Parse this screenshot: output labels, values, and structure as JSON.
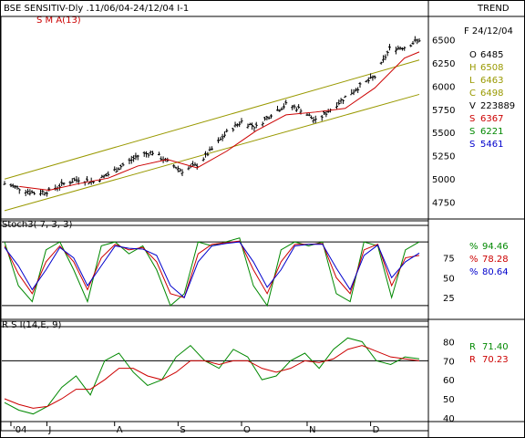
{
  "header": {
    "title": "BSE SENSITIV-Dly .11/06/04-24/12/04  I-1",
    "mode": "TREND"
  },
  "indicators": {
    "sma_label": "S M A(13)",
    "stoch_label": "Stoch3( 7, 3, 3)",
    "rsi_label": "R S I(14,E, 9)"
  },
  "info": {
    "date": "F 24/12/04",
    "rows": [
      {
        "key": "O",
        "value": "6485",
        "color": "#000000"
      },
      {
        "key": "H",
        "value": "6508",
        "color": "#999900"
      },
      {
        "key": "L",
        "value": "6463",
        "color": "#999900"
      },
      {
        "key": "C",
        "value": "6498",
        "color": "#999900"
      },
      {
        "key": "V",
        "value": "223889",
        "color": "#000000"
      },
      {
        "key": "S",
        "value": "6367",
        "color": "#cc0000"
      },
      {
        "key": "S",
        "value": "6221",
        "color": "#008800"
      },
      {
        "key": "S",
        "value": "5461",
        "color": "#0000cc"
      }
    ],
    "stoch_rows": [
      {
        "key": "%",
        "value": "94.46",
        "color": "#008800"
      },
      {
        "key": "%",
        "value": "78.28",
        "color": "#cc0000"
      },
      {
        "key": "%",
        "value": "80.64",
        "color": "#0000cc"
      }
    ],
    "rsi_rows": [
      {
        "key": "R",
        "value": "71.40",
        "color": "#008800"
      },
      {
        "key": "R",
        "value": "70.23",
        "color": "#cc0000"
      }
    ]
  },
  "chart_data": [
    {
      "type": "ohlc",
      "title": "BSE SENSITIV-Dly .11/06/04-24/12/04  I-1",
      "x_range": [
        "2004-06-11",
        "2004-12-24"
      ],
      "ylim": [
        4600,
        6650
      ],
      "yticks": [
        4750,
        5000,
        5250,
        5500,
        5750,
        6000,
        6250,
        6500
      ],
      "x_tick_labels": [
        "'04",
        "J",
        "A",
        "S",
        "O",
        "N",
        "D"
      ],
      "close_path": [
        {
          "x": "2004-06-11",
          "close": 4950
        },
        {
          "x": "2004-06-18",
          "close": 4900
        },
        {
          "x": "2004-06-25",
          "close": 4850
        },
        {
          "x": "2004-07-02",
          "close": 4870
        },
        {
          "x": "2004-07-09",
          "close": 4950
        },
        {
          "x": "2004-07-16",
          "close": 5000
        },
        {
          "x": "2004-07-23",
          "close": 4970
        },
        {
          "x": "2004-07-30",
          "close": 5050
        },
        {
          "x": "2004-08-06",
          "close": 5150
        },
        {
          "x": "2004-08-13",
          "close": 5250
        },
        {
          "x": "2004-08-20",
          "close": 5290
        },
        {
          "x": "2004-08-27",
          "close": 5180
        },
        {
          "x": "2004-09-03",
          "close": 5090
        },
        {
          "x": "2004-09-10",
          "close": 5150
        },
        {
          "x": "2004-09-17",
          "close": 5320
        },
        {
          "x": "2004-09-24",
          "close": 5500
        },
        {
          "x": "2004-10-01",
          "close": 5620
        },
        {
          "x": "2004-10-08",
          "close": 5560
        },
        {
          "x": "2004-10-15",
          "close": 5700
        },
        {
          "x": "2004-10-22",
          "close": 5800
        },
        {
          "x": "2004-10-29",
          "close": 5750
        },
        {
          "x": "2004-11-05",
          "close": 5620
        },
        {
          "x": "2004-11-12",
          "close": 5750
        },
        {
          "x": "2004-11-19",
          "close": 5880
        },
        {
          "x": "2004-11-26",
          "close": 6000
        },
        {
          "x": "2004-12-03",
          "close": 6100
        },
        {
          "x": "2004-12-10",
          "close": 6400
        },
        {
          "x": "2004-12-17",
          "close": 6420
        },
        {
          "x": "2004-12-24",
          "close": 6498
        }
      ],
      "sma": {
        "name": "S M A(13)",
        "color": "#cc0000",
        "points": [
          {
            "x": "2004-06-18",
            "value": 4920
          },
          {
            "x": "2004-07-02",
            "value": 4880
          },
          {
            "x": "2004-07-16",
            "value": 4950
          },
          {
            "x": "2004-07-30",
            "value": 5010
          },
          {
            "x": "2004-08-13",
            "value": 5140
          },
          {
            "x": "2004-08-27",
            "value": 5210
          },
          {
            "x": "2004-09-10",
            "value": 5120
          },
          {
            "x": "2004-09-24",
            "value": 5300
          },
          {
            "x": "2004-10-08",
            "value": 5520
          },
          {
            "x": "2004-10-22",
            "value": 5690
          },
          {
            "x": "2004-11-05",
            "value": 5720
          },
          {
            "x": "2004-11-19",
            "value": 5760
          },
          {
            "x": "2004-12-03",
            "value": 5980
          },
          {
            "x": "2004-12-17",
            "value": 6300
          },
          {
            "x": "2004-12-24",
            "value": 6367
          }
        ]
      },
      "channel": [
        {
          "name": "upper",
          "color": "#999900",
          "from": {
            "x": "2004-06-11",
            "value": 5000
          },
          "to": {
            "x": "2004-12-24",
            "value": 6280
          }
        },
        {
          "name": "lower",
          "color": "#999900",
          "from": {
            "x": "2004-06-11",
            "value": 4660
          },
          "to": {
            "x": "2004-12-24",
            "value": 5910
          }
        }
      ]
    },
    {
      "type": "line",
      "title": "Stoch3( 7, 3, 3)",
      "ylim": [
        0,
        110
      ],
      "yticks": [
        25,
        50,
        75
      ],
      "hlines": [
        15,
        95
      ],
      "series": [
        {
          "name": "%",
          "color": "#008800",
          "values": [
            95,
            40,
            20,
            85,
            95,
            60,
            20,
            90,
            95,
            80,
            90,
            60,
            15,
            30,
            95,
            90,
            95,
            100,
            40,
            15,
            85,
            95,
            90,
            95,
            30,
            20,
            95,
            90,
            25,
            85,
            95
          ]
        },
        {
          "name": "%",
          "color": "#cc0000",
          "values": [
            90,
            55,
            30,
            70,
            90,
            70,
            35,
            75,
            92,
            85,
            88,
            70,
            30,
            25,
            80,
            92,
            94,
            96,
            60,
            30,
            70,
            92,
            92,
            93,
            50,
            30,
            85,
            92,
            40,
            75,
            78
          ]
        },
        {
          "name": "%",
          "color": "#0000cc",
          "values": [
            88,
            65,
            35,
            60,
            88,
            75,
            40,
            65,
            90,
            87,
            86,
            78,
            40,
            25,
            70,
            90,
            93,
            95,
            70,
            38,
            60,
            90,
            92,
            92,
            62,
            35,
            78,
            91,
            50,
            70,
            81
          ]
        }
      ]
    },
    {
      "type": "line",
      "title": "R S I(14,E, 9)",
      "ylim": [
        38,
        86
      ],
      "yticks": [
        40,
        50,
        60,
        70,
        80
      ],
      "hlines": [
        70
      ],
      "series": [
        {
          "name": "R",
          "color": "#008800",
          "values": [
            48,
            44,
            42,
            46,
            56,
            62,
            52,
            70,
            74,
            64,
            57,
            60,
            72,
            78,
            70,
            66,
            76,
            72,
            60,
            62,
            70,
            74,
            66,
            76,
            82,
            80,
            70,
            68,
            72,
            71
          ]
        },
        {
          "name": "R",
          "color": "#cc0000",
          "values": [
            50,
            47,
            45,
            46,
            50,
            55,
            55,
            60,
            66,
            66,
            62,
            60,
            64,
            70,
            70,
            68,
            70,
            70,
            66,
            64,
            66,
            70,
            69,
            71,
            76,
            78,
            75,
            72,
            71,
            70
          ]
        }
      ]
    }
  ]
}
